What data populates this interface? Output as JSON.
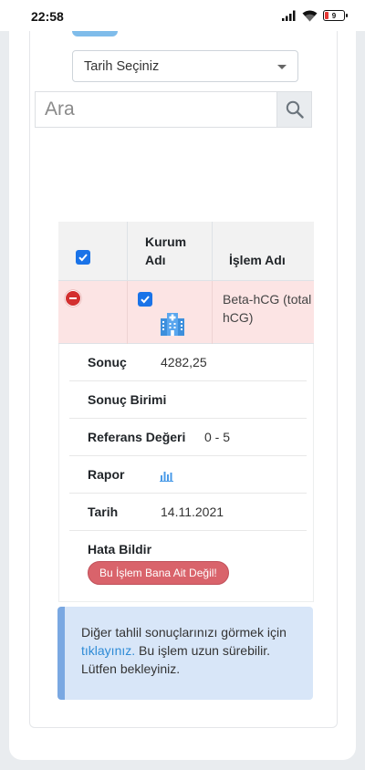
{
  "status_bar": {
    "time": "22:58",
    "battery_level": "9"
  },
  "filter": {
    "date_select_label": "Tarih Seçiniz",
    "search_placeholder": "Ara"
  },
  "table": {
    "headers": {
      "institution": "Kurum Adı",
      "process": "İşlem Adı"
    },
    "row": {
      "process_name": "Beta-hCG (total hCG)",
      "selected": true
    }
  },
  "detail": {
    "result_label": "Sonuç",
    "result_value": "4282,25",
    "unit_label": "Sonuç Birimi",
    "unit_value": "",
    "reference_label": "Referans Değeri",
    "reference_value": "0 - 5",
    "report_label": "Rapor",
    "date_label": "Tarih",
    "date_value": "14.11.2021",
    "report_error_label": "Hata Bildir",
    "report_error_button": "Bu İşlem Bana Ait Değil!"
  },
  "info": {
    "text_before": "Diğer tahlil sonuçlarınızı görmek için ",
    "link_text": "tıklayınız.",
    "text_after": " Bu işlem uzun sürebilir. Lütfen bekleyiniz."
  },
  "colors": {
    "checkbox": "#1a73e8",
    "row_highlight": "#fce4e4",
    "error_button": "#d9636b",
    "info_background": "#d8e6f8",
    "link": "#2e8bd6"
  },
  "icons": [
    "wifi-icon",
    "signal-icon",
    "battery-icon",
    "search-icon",
    "hospital-icon",
    "bar-chart-icon",
    "checkbox-icon",
    "minus-circle-icon"
  ]
}
